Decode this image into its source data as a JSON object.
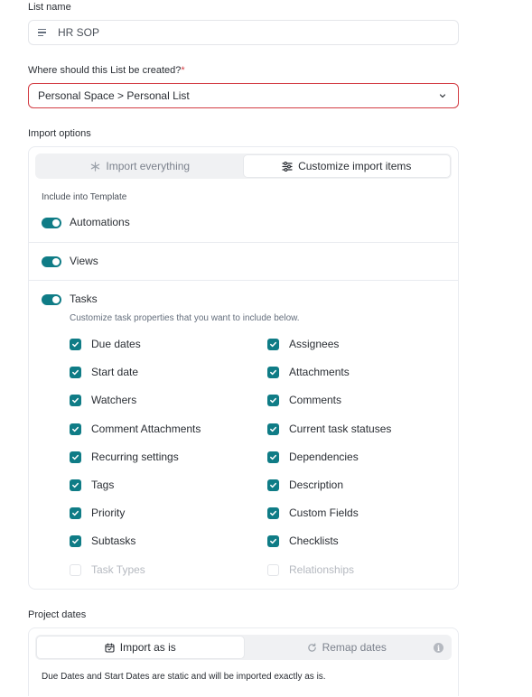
{
  "list_name": {
    "label": "List name",
    "value": "HR SOP"
  },
  "location": {
    "label": "Where should this List be created?",
    "required_mark": "*",
    "value": "Personal Space > Personal List"
  },
  "import_options": {
    "label": "Import options",
    "tabs": [
      {
        "label": "Import everything",
        "icon": "sparkle-icon",
        "active": false
      },
      {
        "label": "Customize import items",
        "icon": "sliders-icon",
        "active": true
      }
    ],
    "include_label": "Include into Template",
    "toggles": [
      {
        "label": "Automations",
        "on": true
      },
      {
        "label": "Views",
        "on": true
      },
      {
        "label": "Tasks",
        "on": true
      }
    ],
    "tasks_hint": "Customize task properties that you want to include below.",
    "left_items": [
      {
        "label": "Due dates",
        "checked": true
      },
      {
        "label": "Start date",
        "checked": true
      },
      {
        "label": "Watchers",
        "checked": true
      },
      {
        "label": "Comment Attachments",
        "checked": true
      },
      {
        "label": "Recurring settings",
        "checked": true
      },
      {
        "label": "Tags",
        "checked": true
      },
      {
        "label": "Priority",
        "checked": true
      },
      {
        "label": "Subtasks",
        "checked": true
      },
      {
        "label": "Task Types",
        "checked": false
      }
    ],
    "right_items": [
      {
        "label": "Assignees",
        "checked": true
      },
      {
        "label": "Attachments",
        "checked": true
      },
      {
        "label": "Comments",
        "checked": true
      },
      {
        "label": "Current task statuses",
        "checked": true
      },
      {
        "label": "Dependencies",
        "checked": true
      },
      {
        "label": "Description",
        "checked": true
      },
      {
        "label": "Custom Fields",
        "checked": true
      },
      {
        "label": "Checklists",
        "checked": true
      },
      {
        "label": "Relationships",
        "checked": false
      }
    ]
  },
  "project_dates": {
    "label": "Project dates",
    "tabs": [
      {
        "label": "Import as is",
        "icon": "calendar-icon",
        "active": true
      },
      {
        "label": "Remap dates",
        "icon": "refresh-icon",
        "active": false
      }
    ],
    "note": "Due Dates and Start Dates are static and will be imported exactly as is."
  },
  "colors": {
    "accent": "#0f7c86",
    "error": "#d33d44"
  }
}
